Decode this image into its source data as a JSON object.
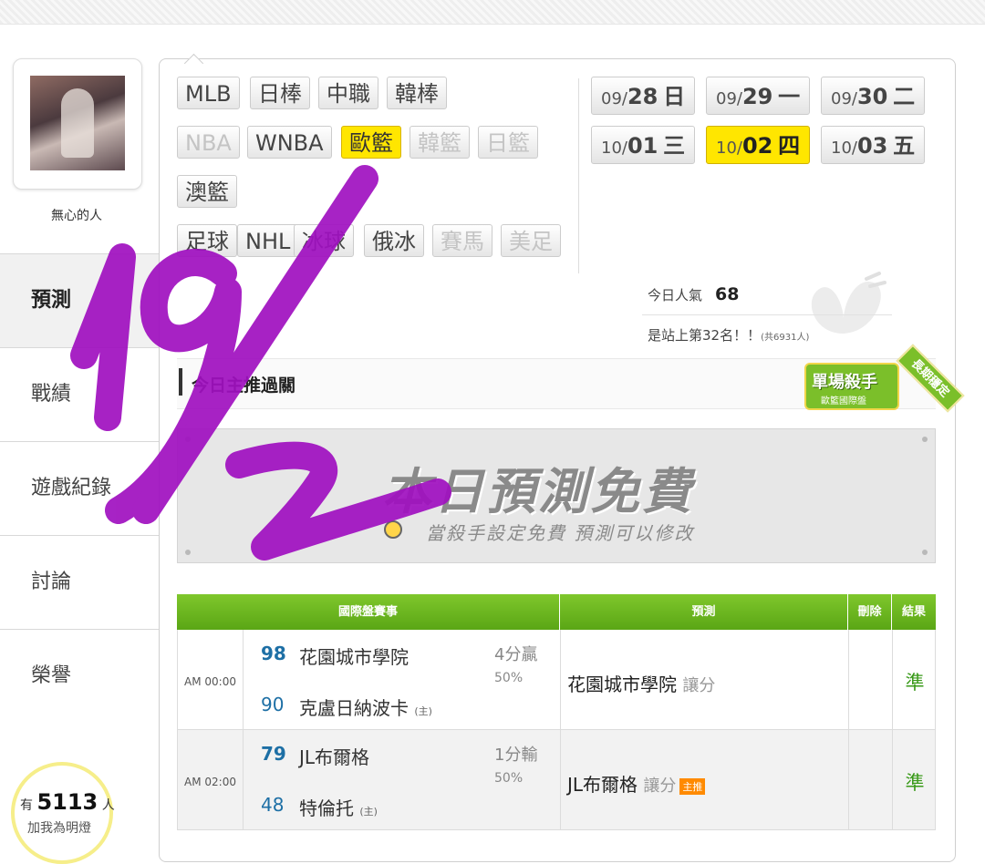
{
  "profile": {
    "name": "無心的人"
  },
  "side_menu": [
    {
      "label": "預測",
      "active": true
    },
    {
      "label": "戰績"
    },
    {
      "label": "遊戲紀錄"
    },
    {
      "label": "討論"
    },
    {
      "label": "榮譽"
    }
  ],
  "lamp": {
    "prefix": "有",
    "count": "5113",
    "suffix": "人",
    "line2": "加我為明燈"
  },
  "sports": {
    "row1": [
      "MLB",
      "日棒",
      "中職",
      "韓棒"
    ],
    "row2": [
      "NBA",
      "WNBA",
      "歐籃",
      "韓籃",
      "日籃"
    ],
    "row3": [
      "澳籃"
    ],
    "row4": [
      "足球",
      "NHL",
      "冰球",
      "俄冰",
      "賽馬",
      "美足"
    ],
    "selected": "歐籃"
  },
  "dates": [
    {
      "md": "09/",
      "day": "28",
      "dow": "日"
    },
    {
      "md": "09/",
      "day": "29",
      "dow": "一"
    },
    {
      "md": "09/",
      "day": "30",
      "dow": "二"
    },
    {
      "md": "10/",
      "day": "01",
      "dow": "三"
    },
    {
      "md": "10/",
      "day": "02",
      "dow": "四",
      "selected": true
    },
    {
      "md": "10/",
      "day": "03",
      "dow": "五"
    }
  ],
  "popularity": {
    "label": "今日人氣",
    "value": "68",
    "rank_text": "是站上第32名！！",
    "total": "(共6931人)"
  },
  "section": {
    "title": "今日主推過關"
  },
  "badge": {
    "title": "單場殺手",
    "subtitle": "歐籃國際盤",
    "ribbon": "長期穩定"
  },
  "banner": {
    "title": "本日預測免費",
    "subtitle": "當殺手設定免費 預測可以修改"
  },
  "table": {
    "headers": [
      "國際盤賽事",
      "預測",
      "刪除",
      "結果"
    ],
    "rows": [
      {
        "time": "AM 00:00",
        "score1": "98",
        "team1": "花園城市學院",
        "score2": "90",
        "team2": "克盧日納波卡",
        "home": "(主)",
        "spread": "4分贏",
        "pct": "50%",
        "pred_team": "花園城市學院",
        "pred_tag": "讓分",
        "main_tag": "",
        "result": "準"
      },
      {
        "time": "AM 02:00",
        "score1": "79",
        "team1": "JL布爾格",
        "score2": "48",
        "team2": "特倫托",
        "home": "(主)",
        "spread": "1分輸",
        "pct": "50%",
        "pred_team": "JL布爾格",
        "pred_tag": "讓分",
        "main_tag": "主推",
        "result": "準"
      }
    ]
  },
  "handwriting": "19/2",
  "colors": {
    "selected": "#ffe600",
    "table_header": "#6cb520",
    "score": "#1d6fa5",
    "result": "#3a9a1a",
    "handwriting": "#a010c0"
  }
}
